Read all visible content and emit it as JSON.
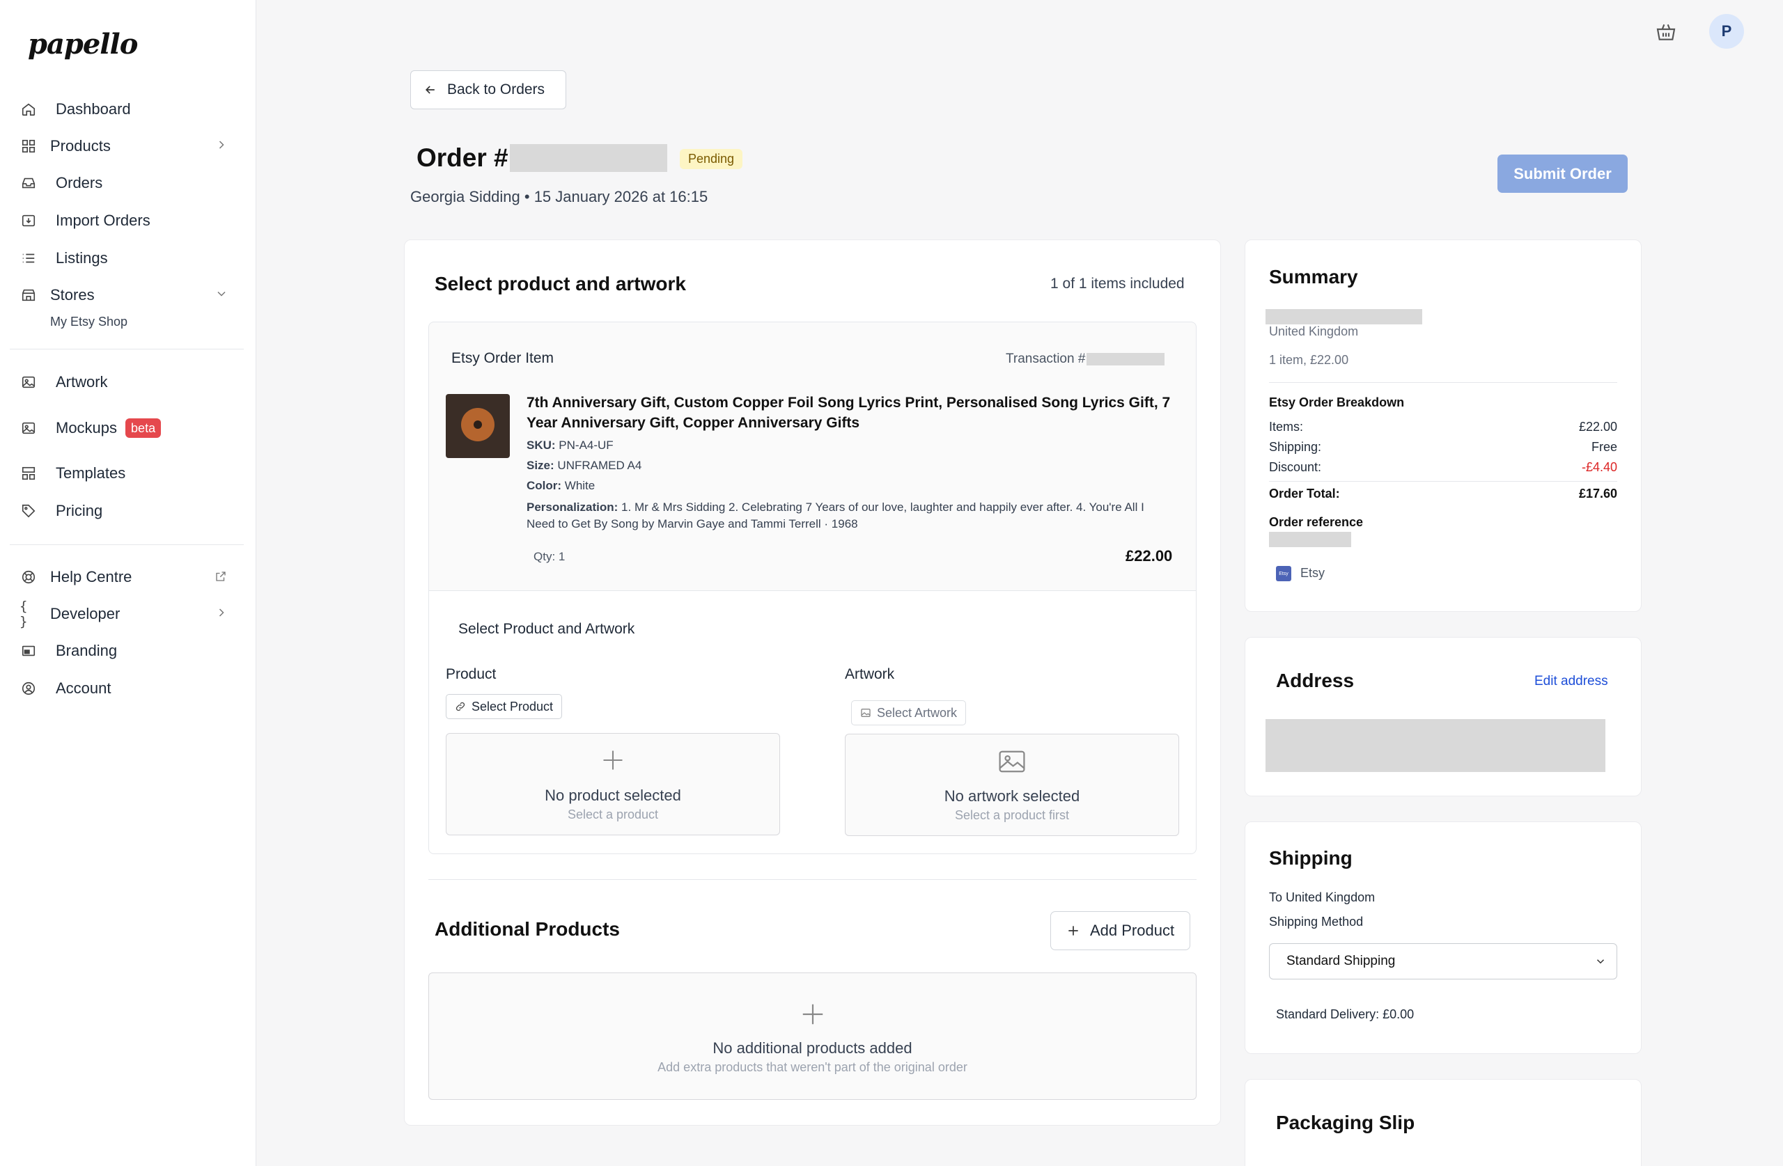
{
  "brand": {
    "logo": "papello"
  },
  "sidebar": {
    "items": [
      {
        "label": "Dashboard"
      },
      {
        "label": "Products"
      },
      {
        "label": "Orders"
      },
      {
        "label": "Import Orders"
      },
      {
        "label": "Listings"
      },
      {
        "label": "Stores"
      },
      {
        "label": "Artwork"
      },
      {
        "label": "Mockups",
        "badge": "beta"
      },
      {
        "label": "Templates"
      },
      {
        "label": "Pricing"
      },
      {
        "label": "Help Centre"
      },
      {
        "label": "Developer"
      },
      {
        "label": "Branding"
      },
      {
        "label": "Account"
      }
    ],
    "stores_sub": "My Etsy Shop"
  },
  "header": {
    "avatar_initial": "P"
  },
  "page": {
    "back_label": "Back to Orders",
    "order_prefix": "Order #",
    "status": "Pending",
    "subline": "Georgia Sidding • 15 January 2026 at 16:15",
    "submit_label": "Submit Order"
  },
  "select_section": {
    "title": "Select product and artwork",
    "count": "1 of 1 items included",
    "item": {
      "source": "Etsy Order Item",
      "transaction_label": "Transaction #",
      "name": "7th Anniversary Gift, Custom Copper Foil Song Lyrics Print, Personalised Song Lyrics Gift, 7 Year Anniversary Gift, Copper Anniversary Gifts",
      "sku_label": "SKU:",
      "sku": "PN-A4-UF",
      "size_label": "Size:",
      "size": "UNFRAMED A4",
      "color_label": "Color:",
      "color": "White",
      "personalization_label": "Personalization:",
      "personalization": "1. Mr & Mrs Sidding 2. Celebrating 7 Years of our love, laughter and happily ever after. 4. You're All I Need to Get By Song by Marvin Gaye and Tammi Terrell · 1968",
      "qty": "Qty: 1",
      "price": "£22.00"
    },
    "sub_title": "Select Product and Artwork",
    "product_label": "Product",
    "select_product": "Select Product",
    "no_product": "No product selected",
    "no_product_hint": "Select a product",
    "artwork_label": "Artwork",
    "select_artwork": "Select Artwork",
    "no_artwork": "No artwork selected",
    "no_artwork_hint": "Select a product first"
  },
  "additional": {
    "title": "Additional Products",
    "add_label": "Add Product",
    "empty": "No additional products added",
    "empty_hint": "Add extra products that weren't part of the original order"
  },
  "summary": {
    "title": "Summary",
    "country": "United Kingdom",
    "items_line": "1 item, £22.00",
    "breakdown_title": "Etsy Order Breakdown",
    "rows": [
      {
        "label": "Items:",
        "value": "£22.00"
      },
      {
        "label": "Shipping:",
        "value": "Free"
      },
      {
        "label": "Discount:",
        "value": "-£4.40"
      }
    ],
    "total_label": "Order Total:",
    "total_value": "£17.60",
    "reference_title": "Order reference",
    "channel": "Etsy"
  },
  "address": {
    "title": "Address",
    "edit_label": "Edit address"
  },
  "shipping": {
    "title": "Shipping",
    "destination": "To United Kingdom",
    "method_label": "Shipping Method",
    "method_value": "Standard Shipping",
    "delivery": "Standard Delivery: £0.00"
  },
  "packaging": {
    "title": "Packaging Slip"
  },
  "colors": {
    "accent": "#8aa8e0",
    "discount": "#dc2626",
    "link": "#1d4ed8",
    "badge": "#e5484d",
    "pending_bg": "#fdf5c4"
  }
}
